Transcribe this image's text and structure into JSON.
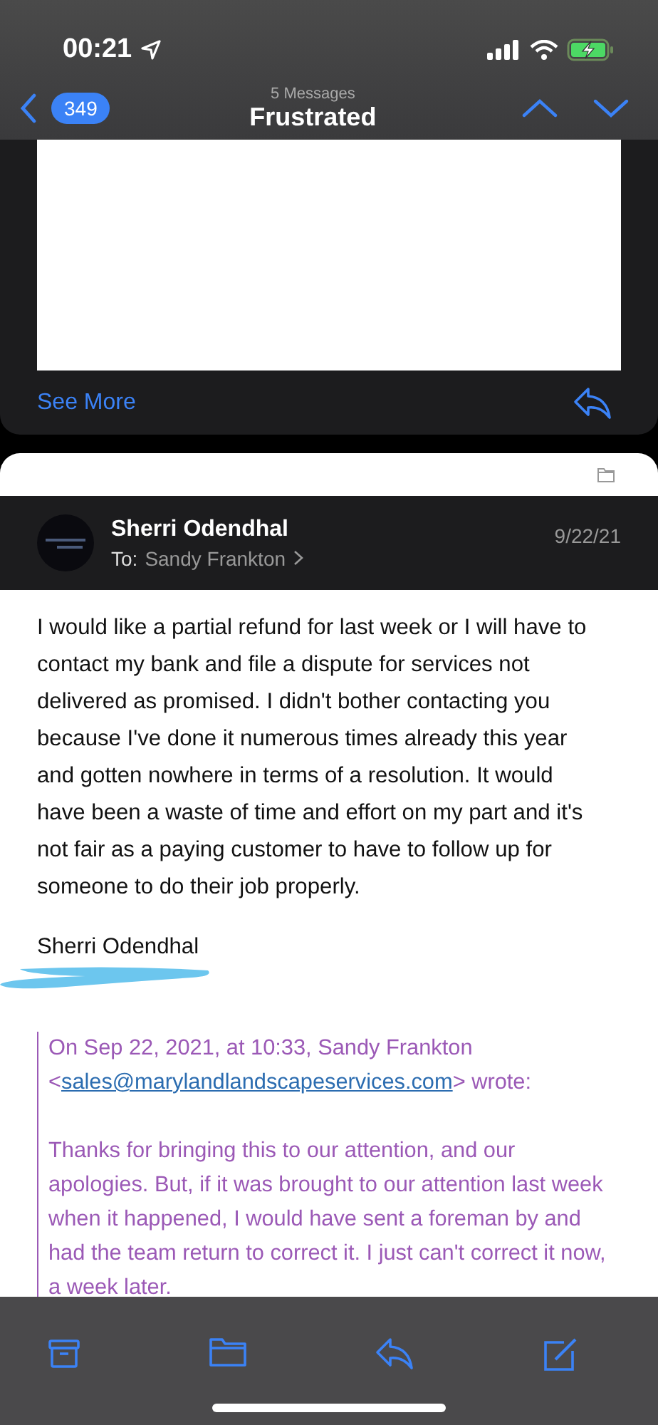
{
  "status_bar": {
    "time": "00:21"
  },
  "nav": {
    "back_count": "349",
    "subtitle": "5 Messages",
    "title": "Frustrated"
  },
  "previous_message": {
    "link": "See More"
  },
  "message": {
    "sender": "Sherri Odendhal",
    "to_label": "To:",
    "recipient": "Sandy Frankton",
    "date": "9/22/21",
    "body": "I would like a partial refund for last week or I will have to contact my bank and file a dispute for services not delivered as promised. I didn't bother contacting you because I've done it numerous times already this year and gotten nowhere in terms of a resolution. It would have been a waste of time and effort on my part and it's not fair as a paying customer to have to follow up for someone to do their job properly.",
    "signature": "Sherri Odendhal",
    "quote": {
      "header": "On Sep 22, 2021, at 10:33, Sandy Frankton",
      "email_open": "<",
      "email": "sales@marylandlandscapeservices.com",
      "header_end": "> wrote:",
      "body": "Thanks for bringing this to our attention, and our apologies.  But, if it was brought to our attention last week when it happened, I would have sent a foreman by and had the team return to correct it.  I just can't correct it now, a week later."
    }
  }
}
